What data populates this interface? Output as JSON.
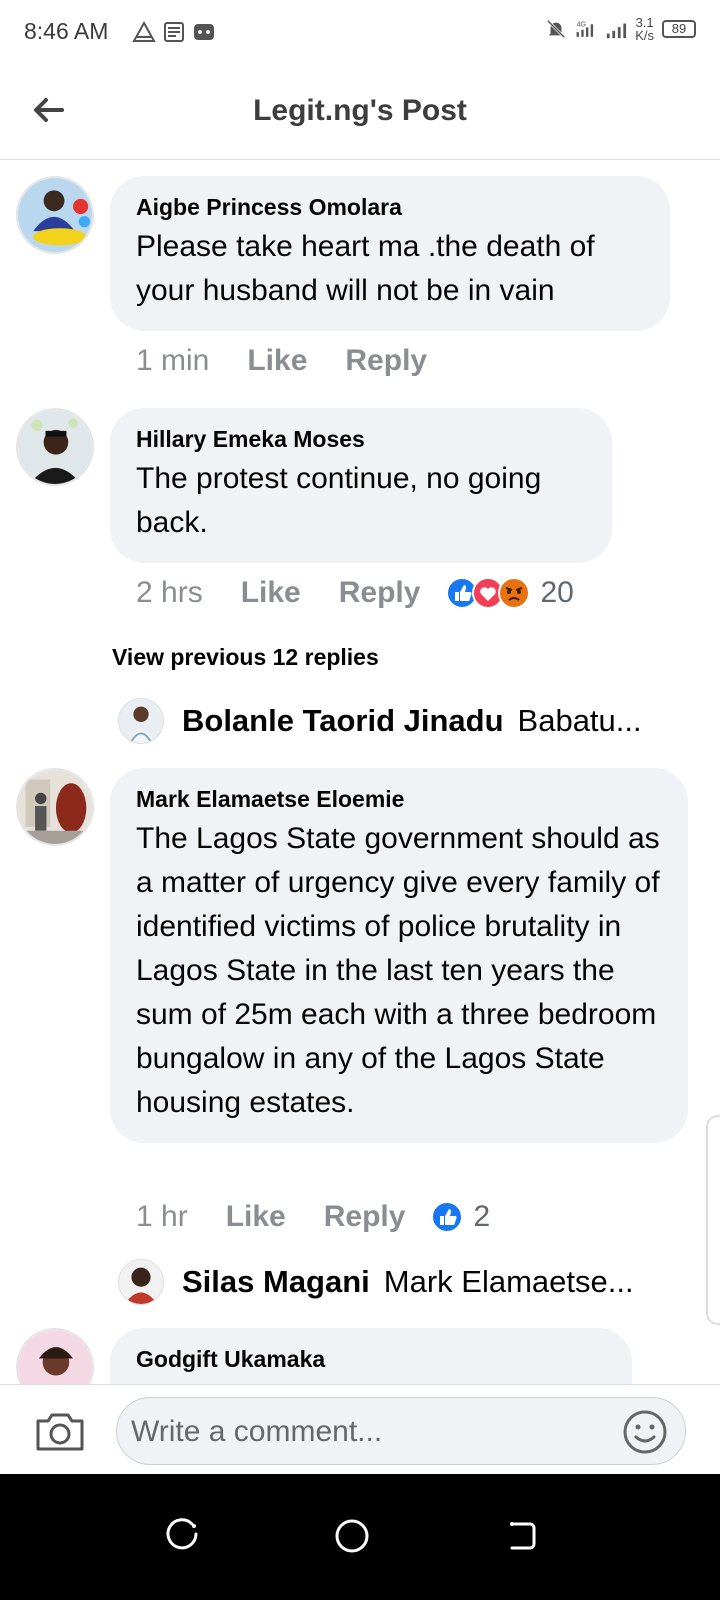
{
  "status_bar": {
    "time": "8:46 AM",
    "network": "4G",
    "speed_value": "3.1",
    "speed_unit": "K/s",
    "battery": "89"
  },
  "header": {
    "title": "Legit.ng's Post"
  },
  "comments": [
    {
      "author": "Aigbe Princess Omolara",
      "text": "Please take heart ma .the death of your husband will not be in vain",
      "time": "1 min",
      "like_label": "Like",
      "reply_label": "Reply"
    },
    {
      "author": "Hillary Emeka Moses",
      "text": "The protest continue, no going back.",
      "time": "2 hrs",
      "like_label": "Like",
      "reply_label": "Reply",
      "reaction_count": "20",
      "reaction_icons": [
        "like-icon",
        "love-icon",
        "angry-icon"
      ]
    },
    {
      "author": "Mark Elamaetse Eloemie",
      "text": "The Lagos State government should as a matter of urgency give every family of identified victims of police brutality in Lagos State in the last ten years the sum of 25m each with a three bedroom bungalow in any of the Lagos State housing estates.",
      "time": "1 hr",
      "like_label": "Like",
      "reply_label": "Reply",
      "reaction_count": "2",
      "reaction_icons": [
        "like-icon"
      ]
    },
    {
      "author": "Godgift Ukamaka"
    }
  ],
  "view_previous": "View previous 12 replies",
  "reply_previews": [
    {
      "name": "Bolanle Taorid Jinadu",
      "snippet": "Babatu..."
    },
    {
      "name": "Silas Magani",
      "snippet": "Mark Elamaetse..."
    }
  ],
  "composer": {
    "placeholder": "Write a comment..."
  },
  "colors": {
    "bubble": "#f0f2f5",
    "secondary_text": "#8a8d91",
    "like_blue": "#1877f2",
    "love_red": "#f33e58",
    "angry_orange": "#e9710f"
  }
}
